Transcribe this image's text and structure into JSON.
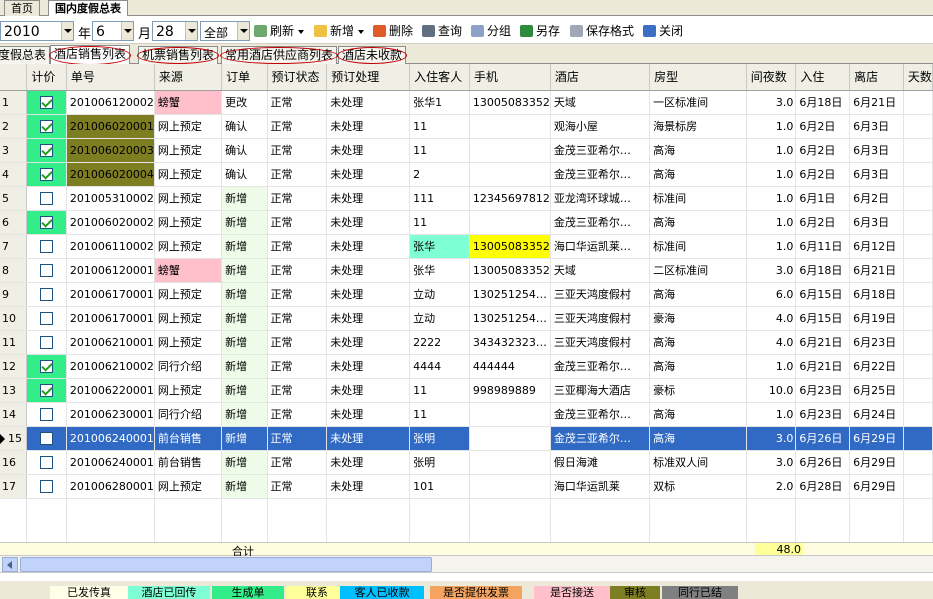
{
  "page_tabs": [
    {
      "label": "首页",
      "active": false
    },
    {
      "label": "国内度假总表",
      "active": true
    }
  ],
  "toolbar": {
    "year": "2010",
    "year_label": "年",
    "month": "6",
    "month_label": "月",
    "day": "28",
    "scope": "全部",
    "refresh": "刷新",
    "add": "新增",
    "delete": "删除",
    "query": "查询",
    "group": "分组",
    "save_as": "另存",
    "save_format": "保存格式",
    "close": "关闭"
  },
  "sub_tabs": [
    {
      "label": "度假总表",
      "active": false,
      "circled": false
    },
    {
      "label": "酒店销售列表",
      "active": true,
      "circled": true
    },
    {
      "label": "机票销售列表",
      "active": false,
      "circled": true
    },
    {
      "label": "常用酒店供应商列表",
      "active": false,
      "circled": true
    },
    {
      "label": "酒店未收款",
      "active": false,
      "circled": true
    }
  ],
  "columns": [
    "",
    "计价",
    "单号",
    "来源",
    "订单",
    "预订状态",
    "预订处理",
    "入住客人",
    "手机",
    "酒店",
    "房型",
    "间夜数",
    "入住",
    "离店",
    "天数"
  ],
  "rows": [
    {
      "n": "1",
      "chk": true,
      "no": "201006120002",
      "src": "螃蟹",
      "order": "更改",
      "status": "正常",
      "proc": "未处理",
      "guest": "张华1",
      "phone": "13005083352",
      "hotel": "天域",
      "room": "一区标准间",
      "nights": "3.0",
      "in": "6月18日",
      "out": "6月21日",
      "bg": {
        "chk": "#33ee88",
        "src": "#ffc0cb"
      }
    },
    {
      "n": "2",
      "chk": true,
      "no": "201006020001",
      "src": "网上预定",
      "order": "确认",
      "status": "正常",
      "proc": "未处理",
      "guest": "11",
      "phone": "",
      "hotel": "观海小屋",
      "room": "海景标房",
      "nights": "1.0",
      "in": "6月2日",
      "out": "6月3日",
      "bg": {
        "chk": "#33ee88",
        "no": "#7d7d22"
      }
    },
    {
      "n": "3",
      "chk": true,
      "no": "201006020003",
      "src": "网上预定",
      "order": "确认",
      "status": "正常",
      "proc": "未处理",
      "guest": "11",
      "phone": "",
      "hotel": "金茂三亚希尔…",
      "room": "高海",
      "nights": "1.0",
      "in": "6月2日",
      "out": "6月3日",
      "bg": {
        "chk": "#33ee88",
        "no": "#7d7d22"
      }
    },
    {
      "n": "4",
      "chk": true,
      "no": "201006020004",
      "src": "网上预定",
      "order": "确认",
      "status": "正常",
      "proc": "未处理",
      "guest": "2",
      "phone": "",
      "hotel": "金茂三亚希尔…",
      "room": "高海",
      "nights": "1.0",
      "in": "6月2日",
      "out": "6月3日",
      "bg": {
        "chk": "#33ee88",
        "no": "#7d7d22"
      }
    },
    {
      "n": "5",
      "chk": false,
      "no": "201005310002",
      "src": "网上预定",
      "order": "新增",
      "status": "正常",
      "proc": "未处理",
      "guest": "111",
      "phone": "12345697812",
      "hotel": "亚龙湾环球城…",
      "room": "标准间",
      "nights": "1.0",
      "in": "6月1日",
      "out": "6月2日",
      "bg": {
        "order": "#eefbe8"
      }
    },
    {
      "n": "6",
      "chk": true,
      "no": "201006020002",
      "src": "网上预定",
      "order": "新增",
      "status": "正常",
      "proc": "未处理",
      "guest": "11",
      "phone": "",
      "hotel": "金茂三亚希尔…",
      "room": "高海",
      "nights": "1.0",
      "in": "6月2日",
      "out": "6月3日",
      "bg": {
        "chk": "#33ee88",
        "order": "#eefbe8"
      }
    },
    {
      "n": "7",
      "chk": false,
      "no": "201006110002",
      "src": "网上预定",
      "order": "新增",
      "status": "正常",
      "proc": "未处理",
      "guest": "张华",
      "phone": "13005083352",
      "hotel": "海口华运凯莱…",
      "room": "标准间",
      "nights": "1.0",
      "in": "6月11日",
      "out": "6月12日",
      "bg": {
        "order": "#eefbe8",
        "guest": "#7fffd4",
        "phone": "#ffff00"
      }
    },
    {
      "n": "8",
      "chk": false,
      "no": "201006120001",
      "src": "螃蟹",
      "order": "新增",
      "status": "正常",
      "proc": "未处理",
      "guest": "张华",
      "phone": "13005083352",
      "hotel": "天域",
      "room": "二区标准间",
      "nights": "3.0",
      "in": "6月18日",
      "out": "6月21日",
      "bg": {
        "src": "#ffc0cb",
        "order": "#eefbe8"
      }
    },
    {
      "n": "9",
      "chk": false,
      "no": "201006170001",
      "src": "网上预定",
      "order": "新增",
      "status": "正常",
      "proc": "未处理",
      "guest": "立动",
      "phone": "130251254…",
      "hotel": "三亚天鸿度假村",
      "room": "高海",
      "nights": "6.0",
      "in": "6月15日",
      "out": "6月18日",
      "bg": {
        "order": "#eefbe8"
      }
    },
    {
      "n": "10",
      "chk": false,
      "no": "201006170001",
      "src": "网上预定",
      "order": "新增",
      "status": "正常",
      "proc": "未处理",
      "guest": "立动",
      "phone": "130251254…",
      "hotel": "三亚天鸿度假村",
      "room": "豪海",
      "nights": "4.0",
      "in": "6月15日",
      "out": "6月19日",
      "bg": {
        "order": "#eefbe8"
      }
    },
    {
      "n": "11",
      "chk": false,
      "no": "201006210001",
      "src": "网上预定",
      "order": "新增",
      "status": "正常",
      "proc": "未处理",
      "guest": "2222",
      "phone": "343432323…",
      "hotel": "三亚天鸿度假村",
      "room": "高海",
      "nights": "4.0",
      "in": "6月21日",
      "out": "6月23日",
      "bg": {
        "order": "#eefbe8"
      }
    },
    {
      "n": "12",
      "chk": true,
      "no": "201006210002",
      "src": "同行介绍",
      "order": "新增",
      "status": "正常",
      "proc": "未处理",
      "guest": "4444",
      "phone": "444444",
      "hotel": "金茂三亚希尔…",
      "room": "高海",
      "nights": "1.0",
      "in": "6月21日",
      "out": "6月22日",
      "bg": {
        "chk": "#33ee88",
        "order": "#eefbe8"
      }
    },
    {
      "n": "13",
      "chk": true,
      "no": "201006220001",
      "src": "网上预定",
      "order": "新增",
      "status": "正常",
      "proc": "未处理",
      "guest": "11",
      "phone": "998989889",
      "hotel": "三亚椰海大酒店",
      "room": "豪标",
      "nights": "10.0",
      "in": "6月23日",
      "out": "6月25日",
      "bg": {
        "chk": "#33ee88",
        "order": "#eefbe8"
      }
    },
    {
      "n": "14",
      "chk": false,
      "no": "201006230001",
      "src": "同行介绍",
      "order": "新增",
      "status": "正常",
      "proc": "未处理",
      "guest": "11",
      "phone": "",
      "hotel": "金茂三亚希尔…",
      "room": "高海",
      "nights": "1.0",
      "in": "6月23日",
      "out": "6月24日",
      "bg": {
        "order": "#eefbe8"
      }
    },
    {
      "n": "15",
      "chk": false,
      "no": "201006240001",
      "src": "前台销售",
      "order": "新增",
      "status": "正常",
      "proc": "未处理",
      "guest": "张明",
      "phone": "",
      "hotel": "金茂三亚希尔…",
      "room": "高海",
      "nights": "3.0",
      "in": "6月26日",
      "out": "6月29日",
      "selected": true,
      "bg": {}
    },
    {
      "n": "16",
      "chk": false,
      "no": "201006240001",
      "src": "前台销售",
      "order": "新增",
      "status": "正常",
      "proc": "未处理",
      "guest": "张明",
      "phone": "",
      "hotel": "假日海滩",
      "room": "标准双人间",
      "nights": "3.0",
      "in": "6月26日",
      "out": "6月29日",
      "bg": {
        "order": "#eefbe8"
      }
    },
    {
      "n": "17",
      "chk": false,
      "no": "201006280001",
      "src": "网上预定",
      "order": "新增",
      "status": "正常",
      "proc": "未处理",
      "guest": "101",
      "phone": "",
      "hotel": "海口华运凯莱",
      "room": "双标",
      "nights": "2.0",
      "in": "6月28日",
      "out": "6月29日",
      "bg": {
        "order": "#eefbe8"
      }
    }
  ],
  "footer": {
    "total_label": "合计",
    "total_nights": "48.0"
  },
  "legend": [
    {
      "label": "已发传真",
      "color": "#ffffe8"
    },
    {
      "label": "酒店已回传",
      "color": "#7fffd4"
    },
    {
      "label": "生成单",
      "color": "#33ee88"
    },
    {
      "label": "联系",
      "color": "#ffff99"
    },
    {
      "label": "客人已收款",
      "color": "#00bfff"
    },
    {
      "label": "是否提供发票",
      "color": "#f4a460"
    },
    {
      "label": "是否接送",
      "color": "#ffc0cb"
    },
    {
      "label": "审核",
      "color": "#7d7d22"
    },
    {
      "label": "同行已结",
      "color": "#808080"
    }
  ]
}
